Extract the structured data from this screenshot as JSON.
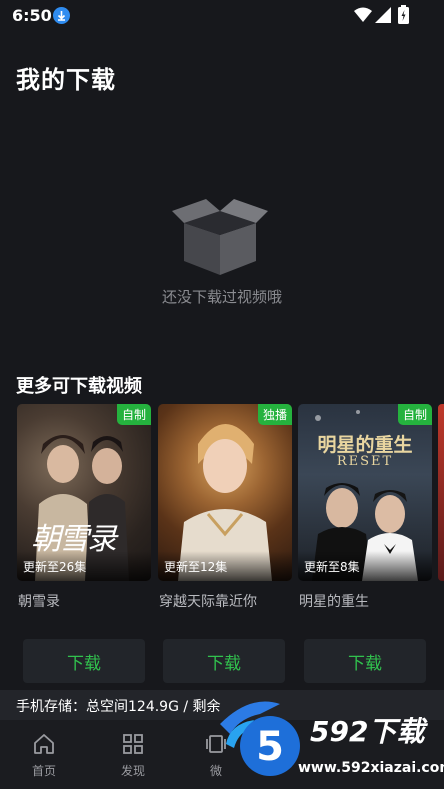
{
  "status_bar": {
    "time": "6:50"
  },
  "page": {
    "title": "我的下载"
  },
  "empty_state": {
    "message": "还没下载过视频哦"
  },
  "recommend": {
    "title": "更多可下载视频",
    "cards": [
      {
        "title": "朝雪录",
        "tag": "自制",
        "update": "更新至26集",
        "poster_text": "朝雪录"
      },
      {
        "title": "穿越天际靠近你",
        "tag": "独播",
        "update": "更新至12集"
      },
      {
        "title": "明星的重生",
        "tag": "自制",
        "update": "更新至8集",
        "poster_text": "明星的重生",
        "poster_subtext": "RESET"
      }
    ],
    "download_label": "下载"
  },
  "storage": {
    "text": "手机存储：总空间124.9G / 剩余"
  },
  "tabbar": {
    "items": [
      {
        "label": "首页",
        "icon": "home-icon"
      },
      {
        "label": "发现",
        "icon": "grid-icon"
      },
      {
        "label": "微",
        "icon": "video-icon"
      }
    ]
  },
  "watermark": {
    "brand": "592下载",
    "url": "www.592xiazai.com",
    "logo_number": "5"
  },
  "colors": {
    "background": "#17181c",
    "accent_green": "#31c24e",
    "tag_green": "#25b23e"
  }
}
